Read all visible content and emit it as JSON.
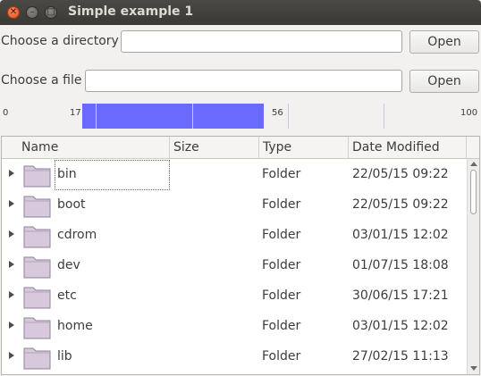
{
  "window": {
    "title": "Simple example 1",
    "close_glyph": "✕",
    "min_glyph": "–",
    "max_glyph": "□"
  },
  "directory_row": {
    "label": "Choose a directory",
    "value": "",
    "button": "Open"
  },
  "file_row": {
    "label": "Choose a file",
    "value": "",
    "button": "Open"
  },
  "range": {
    "min": 0,
    "max": 100,
    "low": 17,
    "high": 56,
    "min_label": "0",
    "max_label": "100",
    "low_label": "17",
    "high_label": "56",
    "fill_color": "#6a6aff"
  },
  "tree": {
    "columns": [
      "Name",
      "Size",
      "Type",
      "Date Modified"
    ],
    "rows": [
      {
        "name": "bin",
        "size": "",
        "type": "Folder",
        "date": "22/05/15 09:22"
      },
      {
        "name": "boot",
        "size": "",
        "type": "Folder",
        "date": "22/05/15 09:22"
      },
      {
        "name": "cdrom",
        "size": "",
        "type": "Folder",
        "date": "03/01/15 12:02"
      },
      {
        "name": "dev",
        "size": "",
        "type": "Folder",
        "date": "01/07/15 18:08"
      },
      {
        "name": "etc",
        "size": "",
        "type": "Folder",
        "date": "30/06/15 17:21"
      },
      {
        "name": "home",
        "size": "",
        "type": "Folder",
        "date": "03/01/15 12:02"
      },
      {
        "name": "lib",
        "size": "",
        "type": "Folder",
        "date": "27/02/15 11:13"
      }
    ],
    "folder_icon": "folder-icon",
    "folder_color": "#d7c8dc"
  }
}
